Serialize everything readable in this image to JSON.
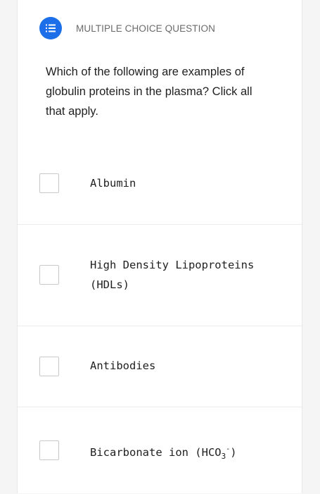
{
  "question_type": {
    "icon": "list-icon",
    "label": "MULTIPLE CHOICE QUESTION",
    "accent": "#1c6fe8"
  },
  "question": {
    "text": "Which of the following are examples of globulin proteins in the plasma? Click all that apply."
  },
  "options": [
    {
      "label": "Albumin",
      "checked": false
    },
    {
      "label": "High Density Lipoproteins (HDLs)",
      "checked": false
    },
    {
      "label": "Antibodies",
      "checked": false
    },
    {
      "label": "Bicarbonate ion (HCO3-)",
      "label_prefix": "Bicarbonate ion (HCO",
      "label_sub": "3",
      "label_sup": "-",
      "label_suffix": ")",
      "checked": false
    }
  ]
}
